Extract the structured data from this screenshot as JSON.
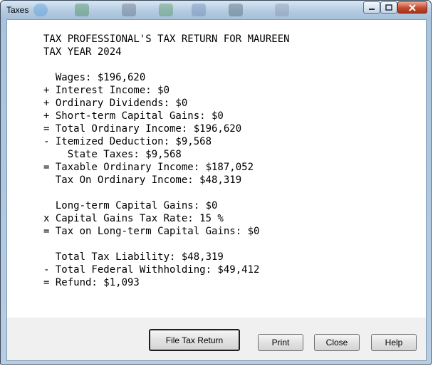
{
  "window": {
    "title": "Taxes"
  },
  "report": {
    "lines": [
      "TAX PROFESSIONAL'S TAX RETURN FOR MAUREEN",
      "TAX YEAR 2024",
      "",
      "  Wages: $196,620",
      "+ Interest Income: $0",
      "+ Ordinary Dividends: $0",
      "+ Short-term Capital Gains: $0",
      "= Total Ordinary Income: $196,620",
      "- Itemized Deduction: $9,568",
      "    State Taxes: $9,568",
      "= Taxable Ordinary Income: $187,052",
      "  Tax On Ordinary Income: $48,319",
      "",
      "  Long-term Capital Gains: $0",
      "x Capital Gains Tax Rate: 15 %",
      "= Tax on Long-term Capital Gains: $0",
      "",
      "  Total Tax Liability: $48,319",
      "- Total Federal Withholding: $49,412",
      "= Refund: $1,093"
    ]
  },
  "buttons": {
    "file": "File Tax Return",
    "print": "Print",
    "close": "Close",
    "help": "Help"
  }
}
